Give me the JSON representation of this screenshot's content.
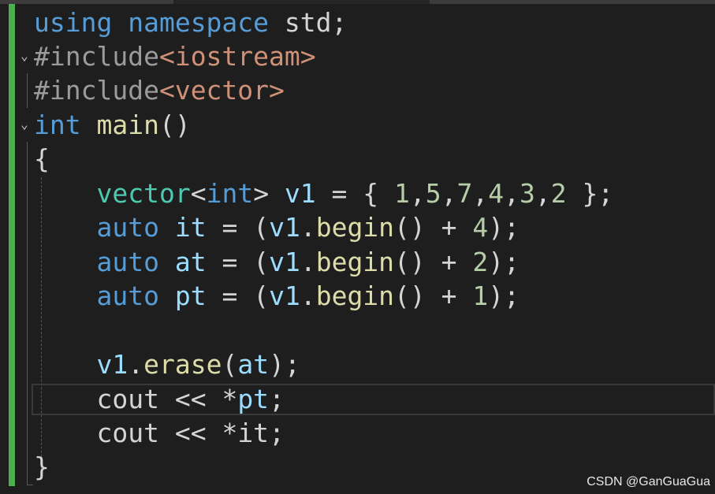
{
  "colors": {
    "background": "#1e1e1e",
    "keyword": "#569cd6",
    "type": "#4ec9b0",
    "function": "#dcdcaa",
    "string": "#ce9178",
    "variable": "#9cdcfe",
    "number": "#b5cea8",
    "preprocessor": "#9b9b9b",
    "text": "#d4d4d4",
    "change_bar": "#4caf50"
  },
  "code": {
    "line1": {
      "t1": "using",
      "t2": " ",
      "t3": "namespace",
      "t4": " std;"
    },
    "line2": {
      "fold": "⌄",
      "t1": "#include",
      "t2": "<iostream>"
    },
    "line3": {
      "t1": "#include",
      "t2": "<vector>"
    },
    "line4": {
      "fold": "⌄",
      "t1": "int",
      "t2": " ",
      "t3": "main",
      "t4": "()"
    },
    "line5": {
      "t1": "{"
    },
    "line6": {
      "indent": "    ",
      "t1": "vector",
      "t2": "<",
      "t3": "int",
      "t4": "> ",
      "t5": "v1",
      "t6": " = { ",
      "t7": "1",
      "t8": ",",
      "t9": "5",
      "t10": ",",
      "t11": "7",
      "t12": ",",
      "t13": "4",
      "t14": ",",
      "t15": "3",
      "t16": ",",
      "t17": "2",
      "t18": " };"
    },
    "line7": {
      "indent": "    ",
      "t1": "auto",
      "t2": " ",
      "t3": "it",
      "t4": " = (",
      "t5": "v1",
      "t6": ".",
      "t7": "begin",
      "t8": "() + ",
      "t9": "4",
      "t10": ");"
    },
    "line8": {
      "indent": "    ",
      "t1": "auto",
      "t2": " ",
      "t3": "at",
      "t4": " = (",
      "t5": "v1",
      "t6": ".",
      "t7": "begin",
      "t8": "() + ",
      "t9": "2",
      "t10": ");"
    },
    "line9": {
      "indent": "    ",
      "t1": "auto",
      "t2": " ",
      "t3": "pt",
      "t4": " = (",
      "t5": "v1",
      "t6": ".",
      "t7": "begin",
      "t8": "() + ",
      "t9": "1",
      "t10": ");"
    },
    "line11": {
      "indent": "    ",
      "t1": "v1",
      "t2": ".",
      "t3": "erase",
      "t4": "(",
      "t5": "at",
      "t6": ");"
    },
    "line12": {
      "indent": "    ",
      "t1": "cout",
      "t2": " << *",
      "t3": "pt",
      "t4": ";"
    },
    "line13": {
      "indent": "    ",
      "t1": "cout",
      "t2": " << *",
      "t3": "it",
      "t4": ";"
    },
    "line14": {
      "t1": "}"
    }
  },
  "watermark": "CSDN @GanGuaGua"
}
